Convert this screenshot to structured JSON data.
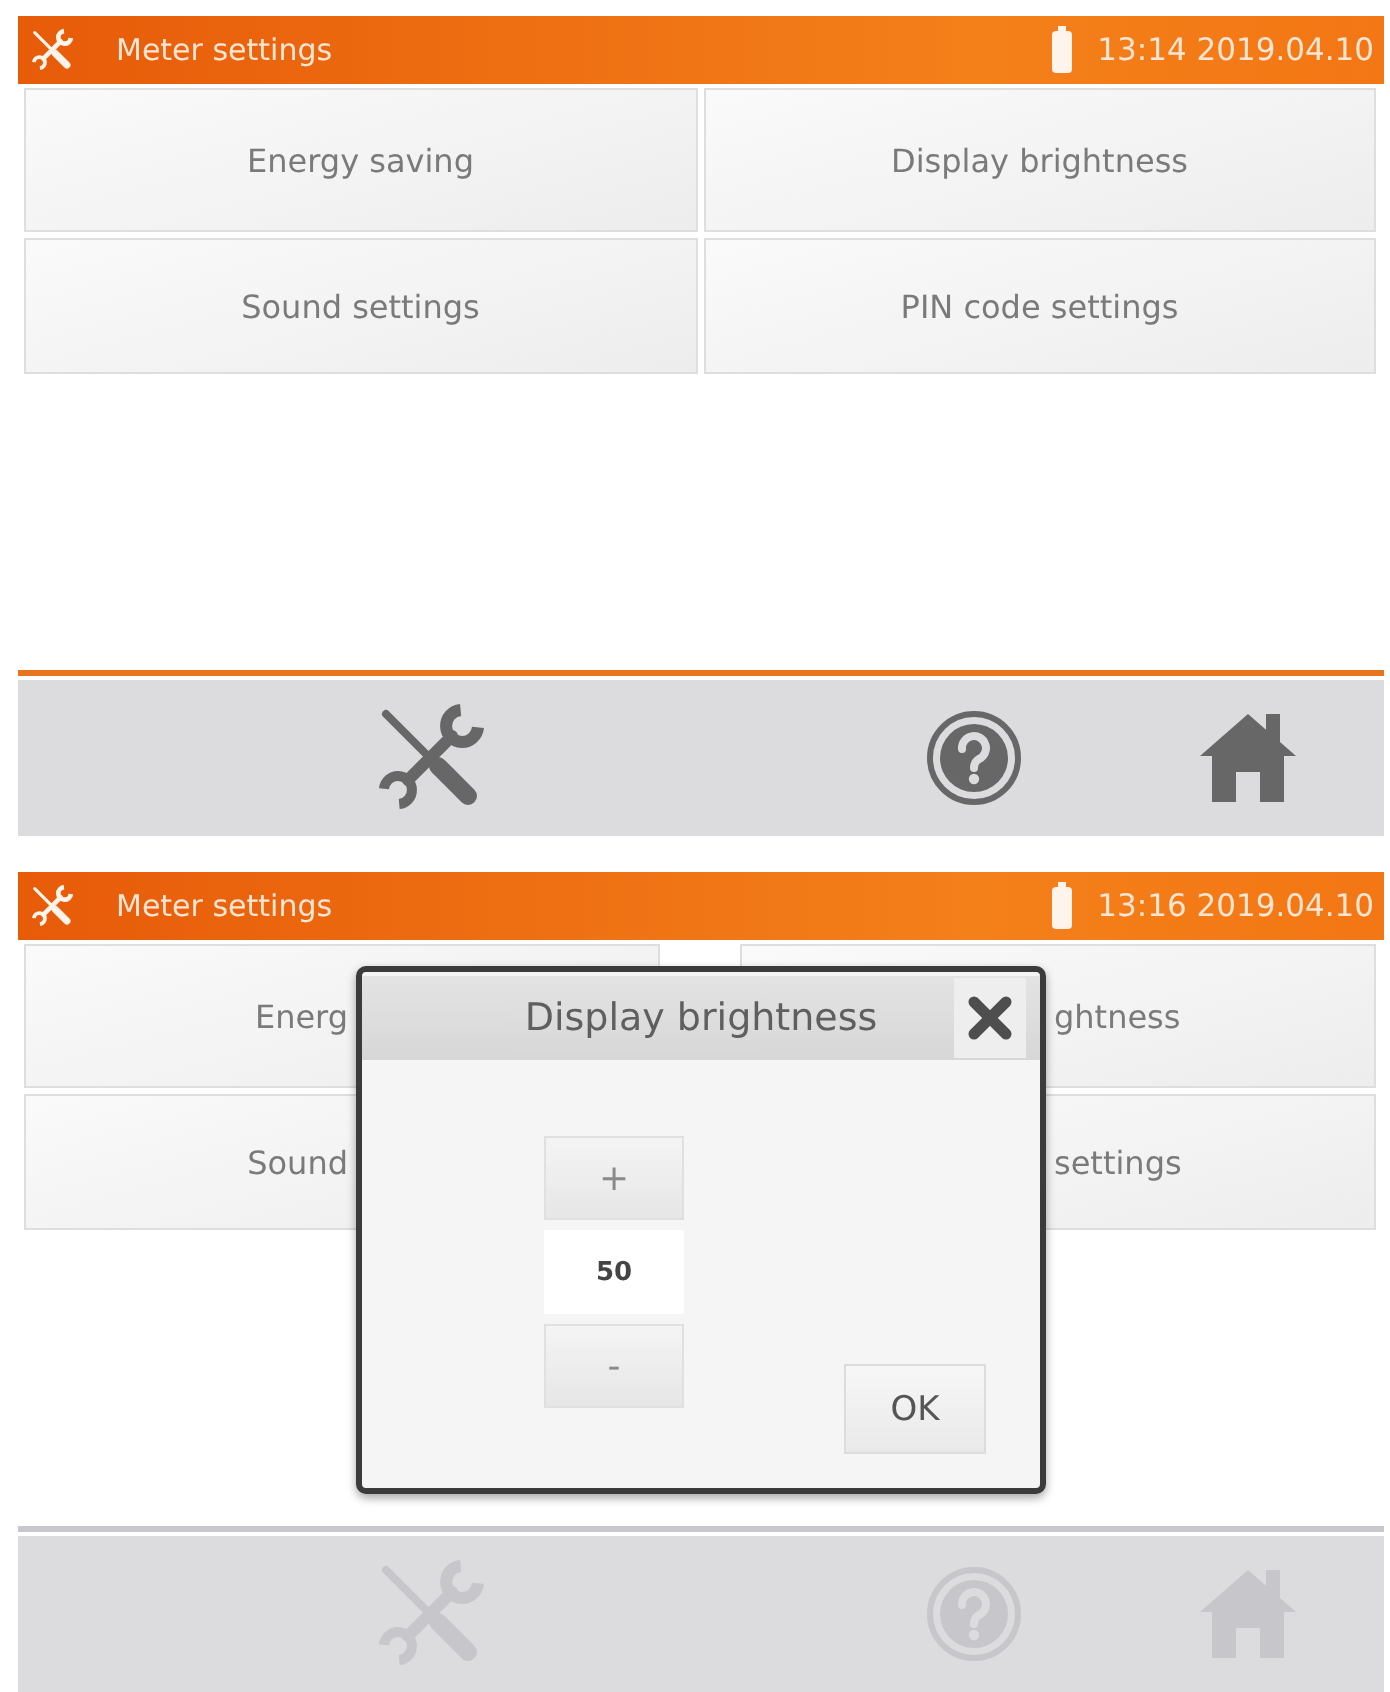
{
  "screens": [
    {
      "title_bar": {
        "title": "Meter settings",
        "clock": "13:14 2019.04.10"
      },
      "menu_buttons": [
        {
          "label": "Energy saving"
        },
        {
          "label": "Display brightness"
        },
        {
          "label": "Sound settings"
        },
        {
          "label": "PIN code settings"
        }
      ],
      "toolbar": {
        "disabled": false,
        "items": [
          {
            "kind": "tools"
          },
          {
            "kind": "help"
          },
          {
            "kind": "home"
          }
        ]
      }
    },
    {
      "title_bar": {
        "title": "Meter settings",
        "clock": "13:16 2019.04.10"
      },
      "menu_buttons": [
        {
          "label": "Energ"
        },
        {
          "label": "ghtness"
        },
        {
          "label": "Sound"
        },
        {
          "label": "settings"
        }
      ],
      "dialog": {
        "title": "Display brightness",
        "increment": "+",
        "value": "50",
        "decrement": "-",
        "ok": "OK"
      },
      "toolbar": {
        "disabled": true,
        "items": [
          {
            "kind": "tools"
          },
          {
            "kind": "help"
          },
          {
            "kind": "home"
          }
        ]
      }
    }
  ]
}
